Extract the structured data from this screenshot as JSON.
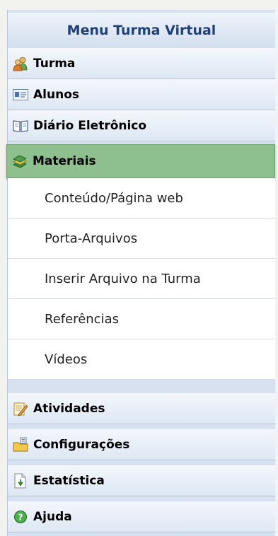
{
  "menu": {
    "title": "Menu Turma Virtual",
    "items_top": [
      {
        "label": "Turma",
        "icon": "people-icon"
      },
      {
        "label": "Alunos",
        "icon": "id-card-icon"
      },
      {
        "label": "Diário Eletrônico",
        "icon": "book-icon"
      },
      {
        "label": "Materiais",
        "icon": "books-stack-icon"
      }
    ],
    "submenu": [
      {
        "label": "Conteúdo/Página web"
      },
      {
        "label": "Porta-Arquivos"
      },
      {
        "label": "Inserir Arquivo na Turma"
      },
      {
        "label": "Referências"
      },
      {
        "label": "Vídeos"
      }
    ],
    "items_bottom": [
      {
        "label": "Atividades",
        "icon": "edit-icon"
      },
      {
        "label": "Configurações",
        "icon": "folder-settings-icon"
      },
      {
        "label": "Estatística",
        "icon": "document-download-icon"
      },
      {
        "label": "Ajuda",
        "icon": "help-icon"
      }
    ]
  }
}
